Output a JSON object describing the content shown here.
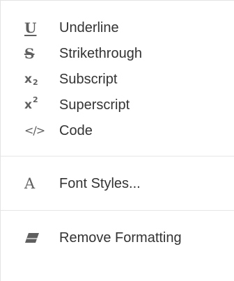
{
  "menu": {
    "items": [
      {
        "label": "Underline",
        "icon": "underline-icon",
        "glyph": "U"
      },
      {
        "label": "Strikethrough",
        "icon": "strikethrough-icon",
        "glyph": "S"
      },
      {
        "label": "Subscript",
        "icon": "subscript-icon",
        "glyph": "x",
        "glyph_mark": "2"
      },
      {
        "label": "Superscript",
        "icon": "superscript-icon",
        "glyph": "x",
        "glyph_mark": "2"
      },
      {
        "label": "Code",
        "icon": "code-icon",
        "glyph": "</>"
      },
      {
        "label": "Font Styles...",
        "icon": "font-styles-icon",
        "glyph": "A"
      },
      {
        "label": "Remove Formatting",
        "icon": "eraser-icon"
      }
    ]
  },
  "colors": {
    "text": "#333333",
    "icon": "#5f5f5f",
    "divider": "#e6e6e6"
  }
}
